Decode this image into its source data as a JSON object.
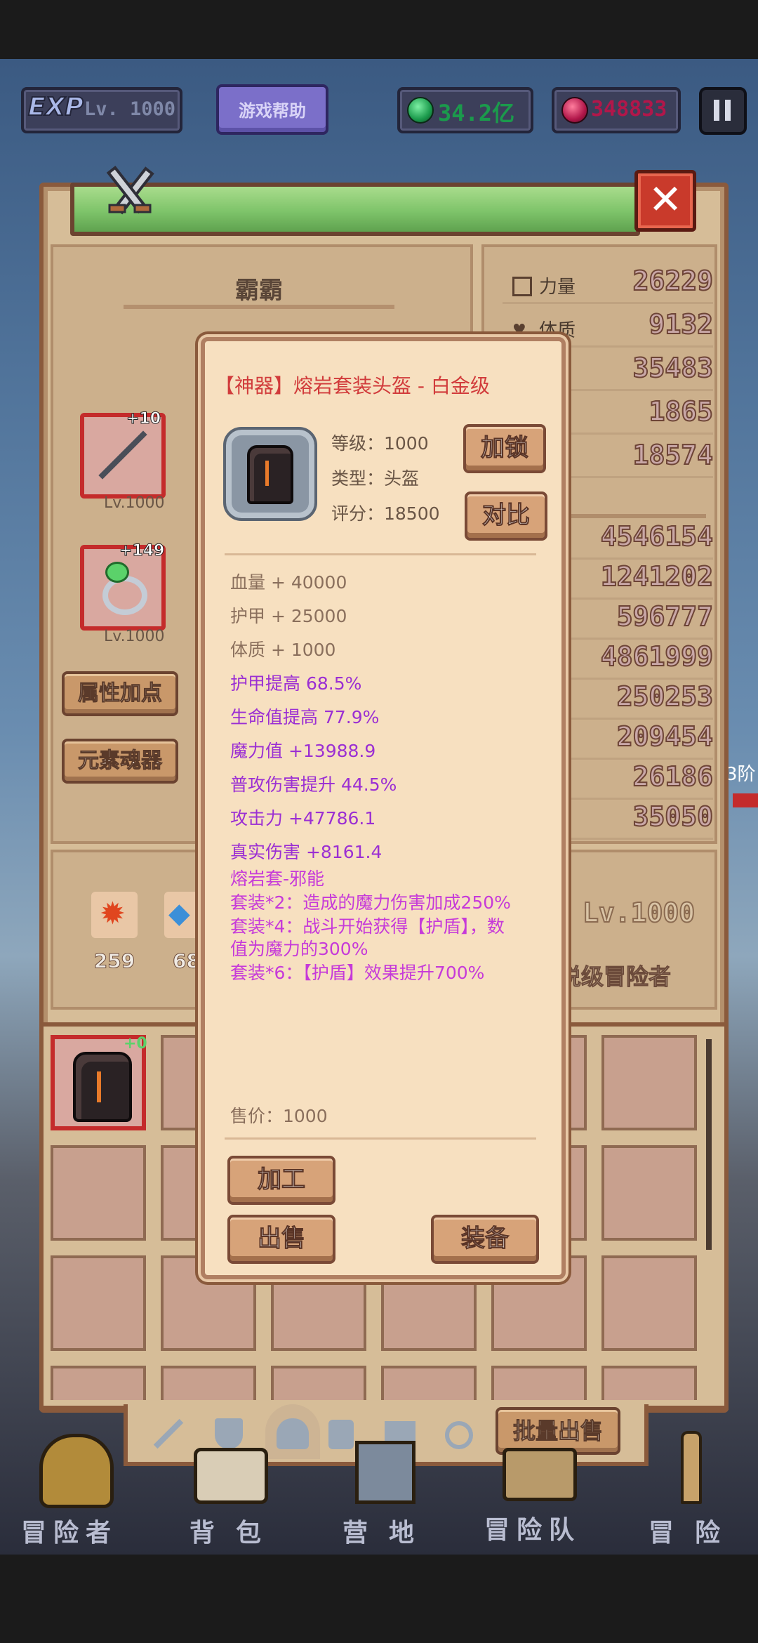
{
  "hud": {
    "exp_badge": "EXP",
    "level": "Lv. 1000",
    "help_button": "游戏帮助",
    "gems": "34.2亿",
    "rubies": "348833"
  },
  "character": {
    "name": "霸霸",
    "weapon_badge": "+10",
    "weapon_level": "Lv.1000",
    "ring_badge": "+149",
    "ring_level": "Lv.1000",
    "attr_button": "属性加点",
    "element_button": "元素魂器",
    "element_counts": [
      "259",
      "68"
    ],
    "rank_level": "Lv.1000",
    "rank_title": "说级冒险者",
    "side_tag": "3阶"
  },
  "stats": [
    {
      "label": "力量",
      "value": "26229"
    },
    {
      "label": "体质",
      "value": "9132"
    },
    {
      "label": "",
      "value": "35483"
    },
    {
      "label": "",
      "value": "1865"
    },
    {
      "label": "",
      "value": "18574"
    },
    {
      "label": "",
      "value": "4546154"
    },
    {
      "label": "",
      "value": "1241202"
    },
    {
      "label": "",
      "value": "596777"
    },
    {
      "label": "",
      "value": "4861999"
    },
    {
      "label": "",
      "value": "250253"
    },
    {
      "label": "",
      "value": "209454"
    },
    {
      "label": "",
      "value": "26186"
    },
    {
      "label": "",
      "value": "35050"
    }
  ],
  "inventory": {
    "first_item_badge": "+0",
    "bulk_sell": "批量出售"
  },
  "item_popup": {
    "title_prefix": "【神器】",
    "title": "熔岩套装头盔 - 白金级",
    "level": "等级：1000",
    "type": "类型：头盔",
    "score": "评分：18500",
    "lock_button": "加锁",
    "compare_button": "对比",
    "base_attrs": [
      "血量 + 40000",
      "护甲 + 25000",
      "体质 + 1000"
    ],
    "bonus_attrs": [
      "护甲提高 68.5%",
      "生命值提高 77.9%",
      "魔力值 +13988.9",
      "普攻伤害提升 44.5%",
      "攻击力 +47786.1",
      "真实伤害 +8161.4"
    ],
    "set_name": "熔岩套-邪能",
    "set_bonus_2": "套装*2：造成的魔力伤害加成250%",
    "set_bonus_4_a": "套装*4：战斗开始获得【护盾】，数",
    "set_bonus_4_b": "值为魔力的300%",
    "set_bonus_6": "套装*6：【护盾】效果提升700%",
    "price": "售价：1000",
    "process_button": "加工",
    "sell_button": "出售",
    "equip_button": "装备"
  },
  "bottom_nav": [
    "冒险者",
    "背包",
    "营地",
    "冒险队",
    "冒险"
  ],
  "colors": {
    "panel": "#d6bd98",
    "popup": "#f7e0c0",
    "purple_text": "#9b2fd3",
    "set_text": "#c63ad9",
    "title_red": "#d13b3b",
    "header_green": "#7ec46a"
  }
}
